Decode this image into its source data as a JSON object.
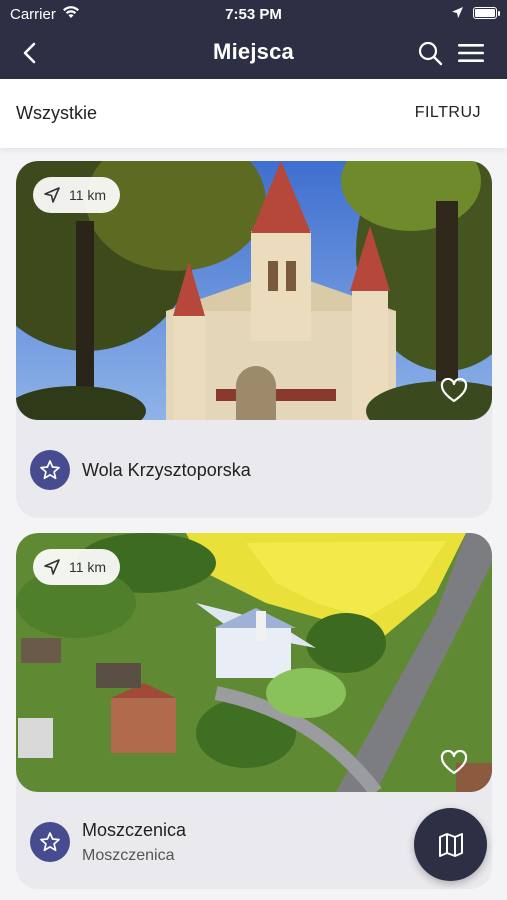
{
  "status_bar": {
    "carrier": "Carrier",
    "time": "7:53 PM"
  },
  "nav": {
    "title": "Miejsca",
    "back_icon": "back-arrow-icon",
    "search_icon": "search-icon",
    "menu_icon": "hamburger-menu-icon"
  },
  "filter_bar": {
    "category": "Wszystkie",
    "filter_label": "FILTRUJ"
  },
  "places": [
    {
      "distance": "11 km",
      "name": "Wola Krzysztoporska",
      "subtitle": "",
      "photo": "church-with-red-spires-among-trees",
      "favorite": false
    },
    {
      "distance": "11 km",
      "name": "Moszczenica",
      "subtitle": "Moszczenica",
      "photo": "aerial-view-church-village-rapeseed-field",
      "favorite": false
    }
  ],
  "map_button": {
    "icon": "map-icon"
  },
  "colors": {
    "header_bg": "#2d2f44",
    "accent": "#474b8f",
    "card_bg": "#e9e9ee",
    "page_bg": "#f4f4f6"
  }
}
